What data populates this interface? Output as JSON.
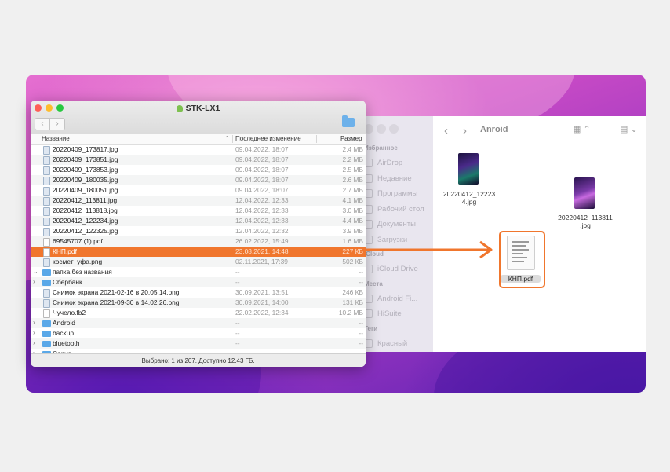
{
  "window": {
    "title": "STK-LX1",
    "status": "Выбрано: 1 из 207. Доступно 12.43 ГБ."
  },
  "columns": {
    "name": "Название",
    "modified": "Последнее изменение",
    "size": "Размер"
  },
  "rows": [
    {
      "name": "20220409_173817.jpg",
      "date": "09.04.2022, 18:07",
      "size": "2.4 МБ",
      "kind": "img"
    },
    {
      "name": "20220409_173851.jpg",
      "date": "09.04.2022, 18:07",
      "size": "2.2 МБ",
      "kind": "img"
    },
    {
      "name": "20220409_173853.jpg",
      "date": "09.04.2022, 18:07",
      "size": "2.5 МБ",
      "kind": "img"
    },
    {
      "name": "20220409_180035.jpg",
      "date": "09.04.2022, 18:07",
      "size": "2.6 МБ",
      "kind": "img"
    },
    {
      "name": "20220409_180051.jpg",
      "date": "09.04.2022, 18:07",
      "size": "2.7 МБ",
      "kind": "img"
    },
    {
      "name": "20220412_113811.jpg",
      "date": "12.04.2022, 12:33",
      "size": "4.1 МБ",
      "kind": "img"
    },
    {
      "name": "20220412_113818.jpg",
      "date": "12.04.2022, 12:33",
      "size": "3.0 МБ",
      "kind": "img"
    },
    {
      "name": "20220412_122234.jpg",
      "date": "12.04.2022, 12:33",
      "size": "4.4 МБ",
      "kind": "img"
    },
    {
      "name": "20220412_122325.jpg",
      "date": "12.04.2022, 12:32",
      "size": "3.9 МБ",
      "kind": "img"
    },
    {
      "name": "69545707 (1).pdf",
      "date": "26.02.2022, 15:49",
      "size": "1.6 МБ",
      "kind": "doc"
    },
    {
      "name": "КНП.pdf",
      "date": "23.08.2021, 14:48",
      "size": "227 КБ",
      "kind": "doc",
      "selected": true
    },
    {
      "name": "космет_уфа.png",
      "date": "02.11.2021, 17:39",
      "size": "502 КБ",
      "kind": "img"
    },
    {
      "name": "папка без названия",
      "date": "--",
      "size": "--",
      "kind": "folder",
      "chevron": "expanded"
    },
    {
      "name": "Сбербанк",
      "date": "--",
      "size": "--",
      "kind": "folder",
      "chevron": "collapsed"
    },
    {
      "name": "Снимок экрана 2021-02-16 в 20.05.14.png",
      "date": "30.09.2021, 13:51",
      "size": "246 КБ",
      "kind": "img"
    },
    {
      "name": "Снимок экрана 2021-09-30 в 14.02.26.png",
      "date": "30.09.2021, 14:00",
      "size": "131 КБ",
      "kind": "img"
    },
    {
      "name": "Чучело.fb2",
      "date": "22.02.2022, 12:34",
      "size": "10.2 МБ",
      "kind": "doc"
    },
    {
      "name": "Android",
      "date": "--",
      "size": "--",
      "kind": "folder",
      "chevron": "collapsed"
    },
    {
      "name": "backup",
      "date": "--",
      "size": "--",
      "kind": "folder",
      "chevron": "collapsed"
    },
    {
      "name": "bluetooth",
      "date": "--",
      "size": "--",
      "kind": "folder",
      "chevron": "collapsed"
    },
    {
      "name": "Canva",
      "date": "--",
      "size": "--",
      "kind": "folder",
      "chevron": "collapsed"
    }
  ],
  "finder": {
    "title": "Anroid",
    "sidebar": [
      {
        "type": "head",
        "label": "Избранное"
      },
      {
        "type": "item",
        "label": "AirDrop"
      },
      {
        "type": "item",
        "label": "Недавние"
      },
      {
        "type": "item",
        "label": "Программы"
      },
      {
        "type": "item",
        "label": "Рабочий стол"
      },
      {
        "type": "item",
        "label": "Документы"
      },
      {
        "type": "item",
        "label": "Загрузки"
      },
      {
        "type": "head",
        "label": "iCloud"
      },
      {
        "type": "item",
        "label": "iCloud Drive"
      },
      {
        "type": "head",
        "label": "Места"
      },
      {
        "type": "item",
        "label": "Android Fi..."
      },
      {
        "type": "item",
        "label": "HiSuite"
      },
      {
        "type": "head",
        "label": "Теги"
      },
      {
        "type": "item",
        "label": "Красный"
      }
    ],
    "files": [
      {
        "label": "20220412_12223\n4.jpg"
      },
      {
        "label": "20220412_113811\n.jpg"
      }
    ],
    "dropped_file": "КНП.pdf"
  },
  "colors": {
    "accent": "#f0762d",
    "folder": "#5aa8e8"
  }
}
